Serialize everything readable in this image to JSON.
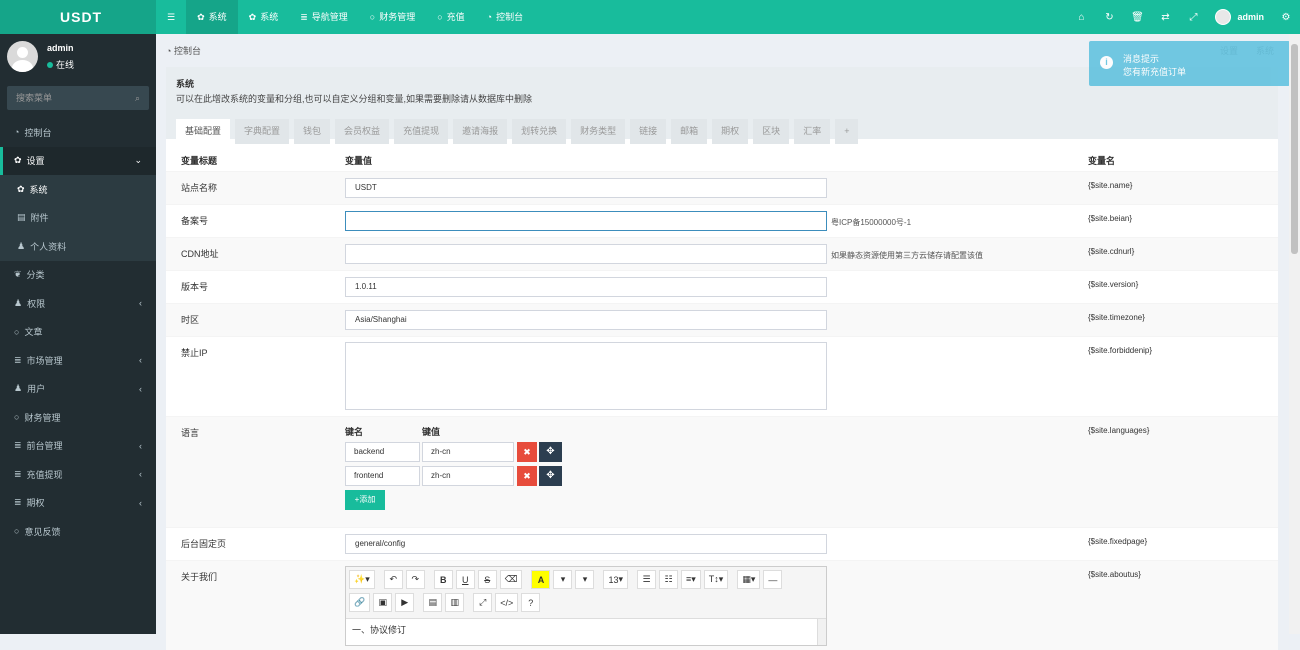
{
  "topbar": {
    "logo": "USDT",
    "nav": [
      {
        "label": "系统",
        "icon": "gear-icon",
        "active": true
      },
      {
        "label": "系统",
        "icon": "gear-icon"
      },
      {
        "label": "导航管理",
        "icon": "list-icon"
      },
      {
        "label": "财务管理",
        "icon": "circle-icon"
      },
      {
        "label": "充值",
        "icon": "circle-icon"
      },
      {
        "label": "控制台",
        "icon": "dashboard-icon"
      }
    ],
    "user": "admin"
  },
  "sidebar": {
    "username": "admin",
    "status": "在线",
    "search_placeholder": "搜索菜单",
    "items": [
      {
        "label": "控制台",
        "icon": "dashboard-icon"
      },
      {
        "label": "设置",
        "icon": "cogs-icon",
        "open": true
      },
      {
        "label": "分类",
        "icon": "leaf-icon"
      },
      {
        "label": "权限",
        "icon": "group-icon"
      },
      {
        "label": "文章",
        "icon": "circle-icon"
      },
      {
        "label": "市场管理",
        "icon": "list-icon"
      },
      {
        "label": "用户",
        "icon": "user-icon"
      },
      {
        "label": "财务管理",
        "icon": "circle-icon"
      },
      {
        "label": "前台管理",
        "icon": "list-icon"
      },
      {
        "label": "充值提现",
        "icon": "list-icon"
      },
      {
        "label": "期权",
        "icon": "list-icon"
      },
      {
        "label": "意见反馈",
        "icon": "circle-icon"
      }
    ],
    "subitems": [
      {
        "label": "系统",
        "icon": "gear-icon"
      },
      {
        "label": "附件",
        "icon": "file-icon"
      },
      {
        "label": "个人资料",
        "icon": "user-icon"
      }
    ]
  },
  "breadcrumb": {
    "label": "控制台",
    "right": [
      "设置",
      "系统"
    ]
  },
  "panel": {
    "title": "系统",
    "desc": "可以在此增改系统的变量和分组,也可以自定义分组和变量,如果需要删除请从数据库中删除",
    "tabs": [
      "基础配置",
      "字典配置",
      "钱包",
      "会员权益",
      "充值提现",
      "邀请海报",
      "划转兑换",
      "财务类型",
      "链接",
      "邮箱",
      "期权",
      "区块",
      "汇率",
      "+"
    ]
  },
  "table": {
    "headers": {
      "title": "变量标题",
      "value": "变量值",
      "name": "变量名"
    },
    "rows": [
      {
        "label": "站点名称",
        "value": "USDT",
        "tip": "",
        "name": "{$site.name}"
      },
      {
        "label": "备案号",
        "value": "",
        "tip": "粤ICP备15000000号-1",
        "name": "{$site.beian}"
      },
      {
        "label": "CDN地址",
        "value": "",
        "tip": "如果静态资源使用第三方云储存请配置该值",
        "name": "{$site.cdnurl}"
      },
      {
        "label": "版本号",
        "value": "1.0.11",
        "tip": "",
        "name": "{$site.version}"
      },
      {
        "label": "时区",
        "value": "Asia/Shanghai",
        "tip": "",
        "name": "{$site.timezone}"
      },
      {
        "label": "禁止IP",
        "value": "",
        "tip": "",
        "name": "{$site.forbiddenip}"
      }
    ],
    "languages": {
      "label": "语言",
      "key_header": "键名",
      "val_header": "键值",
      "pairs": [
        {
          "key": "backend",
          "value": "zh-cn"
        },
        {
          "key": "frontend",
          "value": "zh-cn"
        }
      ],
      "add_label": "+添加",
      "name": "{$site.languages}"
    },
    "fixedpage": {
      "label": "后台固定页",
      "value": "general/config",
      "name": "{$site.fixedpage}"
    },
    "aboutus": {
      "label": "关于我们",
      "content": "一、协议修订",
      "name": "{$site.aboutus}",
      "font_size": "13"
    }
  },
  "toast": {
    "title": "消息提示",
    "message": "您有新充值订单"
  }
}
